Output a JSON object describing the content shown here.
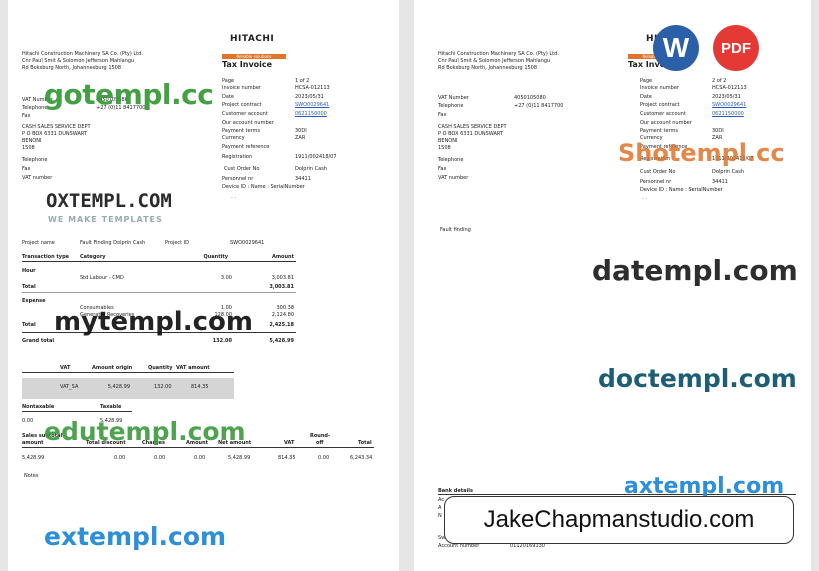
{
  "brand": "HITACHI",
  "banner": "Reliable solutions",
  "doc_title": "Tax Invoice",
  "company": {
    "line1": "Hitachi Construction Machinery SA Co. (Pty) Ltd.",
    "line2": "Cnr Paul Smit & Solomon Jefferson Mahlangu",
    "line3": "Rd Boksburg North, Johannesburg 1508"
  },
  "left_contact": [
    {
      "label": "VAT Number",
      "value": "4050105080"
    },
    {
      "label": "Telephone",
      "value": "+27 (0)11 8417700"
    },
    {
      "label": "Fax",
      "value": ""
    }
  ],
  "customer": {
    "line1": "CASH SALES SERVICE DEPT",
    "line2": "P O BOX 6331 DUNSWART",
    "line3": "BENONI",
    "line4": "1508"
  },
  "customer_contact": [
    {
      "label": "Telephone",
      "value": ""
    },
    {
      "label": "Fax",
      "value": ""
    },
    {
      "label": "VAT number",
      "value": ""
    }
  ],
  "meta_left": [
    {
      "label": "Page",
      "value": "1 of 2",
      "link": false
    },
    {
      "label": "Invoice number",
      "value": "HCSA-012113",
      "link": false
    },
    {
      "label": "Date",
      "value": "2023/05/31",
      "link": false
    },
    {
      "label": "Project contract",
      "value": "SWO0029641",
      "link": true
    },
    {
      "label": "Customer account",
      "value": "0621150000",
      "link": true
    },
    {
      "label": "Our account number",
      "value": "",
      "link": false
    },
    {
      "label": "Payment terms",
      "value": "30DI",
      "link": false
    },
    {
      "label": "Currency",
      "value": "ZAR",
      "link": false
    },
    {
      "label": "Payment reference",
      "value": "",
      "link": false
    },
    {
      "label": "Registration",
      "value": "1911/002418/07",
      "link": false
    },
    {
      "label": "Cust Order No",
      "value": "Dolprin Cash",
      "link": false
    },
    {
      "label": "Personnel nr",
      "value": "34411",
      "link": false
    }
  ],
  "meta_right": [
    {
      "label": "Page",
      "value": "2 of 2",
      "link": false
    },
    {
      "label": "Invoice number",
      "value": "HCSA-012113",
      "link": false
    },
    {
      "label": "Date",
      "value": "2023/05/31",
      "link": false
    },
    {
      "label": "Project contract",
      "value": "SWO0029641",
      "link": true
    },
    {
      "label": "Customer account",
      "value": "0621150000",
      "link": true
    },
    {
      "label": "Our account number",
      "value": "",
      "link": false
    },
    {
      "label": "Payment terms",
      "value": "30DI",
      "link": false
    },
    {
      "label": "Currency",
      "value": "ZAR",
      "link": false
    },
    {
      "label": "Payment reference",
      "value": "",
      "link": false
    },
    {
      "label": "Registration",
      "value": "1911/002418/07",
      "link": false
    },
    {
      "label": "Cust Order No",
      "value": "Dolprin Cash",
      "link": false
    },
    {
      "label": "Personnel nr",
      "value": "34411",
      "link": false
    }
  ],
  "device_id": "Device ID : Name : SerialNumber",
  "device_dashes": "- -",
  "project": {
    "label": "Project name",
    "name": "Fault Finding Dolprin Cash",
    "id_label": "Project ID",
    "id": "SWO0029641"
  },
  "lines_header": {
    "type": "Transaction type",
    "category": "Category",
    "quantity": "Quantity",
    "amount": "Amount"
  },
  "hour": {
    "title": "Hour",
    "row": {
      "category": "Std Labour - CMD",
      "quantity": "3.00",
      "amount": "3,003.81"
    },
    "total_label": "Total",
    "total_amount": "3,003.81"
  },
  "expense": {
    "title": "Expense",
    "rows": [
      {
        "category": "Consumables",
        "quantity": "1.00",
        "amount": "300.38"
      },
      {
        "category": "Generator Recoveries",
        "quantity": "128.00",
        "amount": "2,124.80"
      }
    ],
    "total_label": "Total",
    "total_amount": "2,425.18"
  },
  "grand_total": {
    "label": "Grand total",
    "quantity": "132.00",
    "amount": "5,428.99"
  },
  "vat_table": {
    "headers": [
      "VAT",
      "Amount origin",
      "Quantity",
      "VAT amount"
    ],
    "row": [
      "VAT_SA",
      "5,428.99",
      "132.00",
      "814.35"
    ]
  },
  "nontaxable": {
    "label": "Nontaxable",
    "taxable_label": "Taxable",
    "value": "0.00",
    "taxable_value": "5,428.99"
  },
  "summary": {
    "top_headers": [
      "Sales subtotal",
      "Round-"
    ],
    "headers": [
      "amount",
      "Total discount",
      "Charges",
      "Amount",
      "Net amount",
      "VAT",
      "off",
      "Total"
    ],
    "values": [
      "5,428.99",
      "0.00",
      "0.00",
      "0.00",
      "5,428.99",
      "814.35",
      "0.00",
      "6,243.34"
    ]
  },
  "notes_label": "Notes",
  "fault_text": "Fault finding",
  "bank_details": "Bank details",
  "bank_rows": [
    "Ac",
    "A",
    "N",
    "Sw",
    "Account number"
  ],
  "account_number_value": "01120169130",
  "watermarks": {
    "gotempl": "gotempl.cc",
    "oxtempl": "OXTEMPL.COM",
    "oxtempl_sub": "WE MAKE TEMPLATES",
    "mytempl": "mytempl.com",
    "edutempl": "edutempl.com",
    "extempl": "extempl.com",
    "shotempl": "Shotempl.cc",
    "datempl": "datempl.com",
    "doctempl": "doctempl.com",
    "axtempl": "axtempl.com",
    "jake": "JakeChapmanstudio.com"
  },
  "format_buttons": {
    "word": "W",
    "pdf": "PDF"
  },
  "colors": {
    "banner": "#e0742a",
    "link": "#2a5db0",
    "word": "#2b5fa8",
    "pdf": "#e53935",
    "gotempl_green": "#3b9b3b",
    "doctempl_teal": "#1d5e74",
    "extempl_blue": "#2d8fd8"
  }
}
